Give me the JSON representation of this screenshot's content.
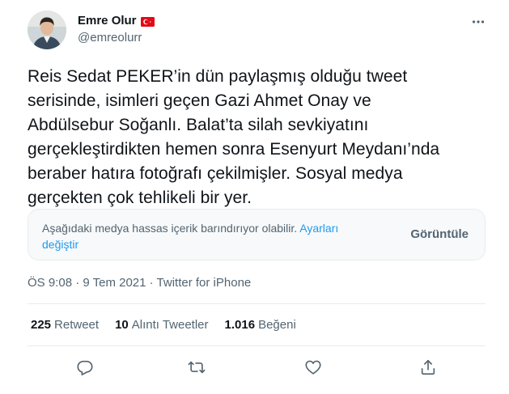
{
  "author": {
    "display_name": "Emre Olur",
    "handle": "@emreolurr",
    "flag_icon": "turkey-flag-icon"
  },
  "tweet": {
    "lines": [
      "Reis Sedat PEKER’in dün paylaşmış olduğu tweet",
      "serisinde, isimleri geçen Gazi Ahmet Onay ve",
      "Abdülsebur Soğanlı. Balat’ta silah sevkiyatını",
      "gerçekleştirdikten hemen sonra Esenyurt Meydanı’nda",
      "beraber hatıra fotoğrafı çekilmişler. Sosyal medya",
      "gerçekten çok tehlikeli bir yer."
    ]
  },
  "sensitive_media": {
    "warning": "Aşağıdaki medya hassas içerik barındırıyor olabilir. ",
    "settings_link": "Ayarları değiştir",
    "view_label": "Görüntüle"
  },
  "meta": {
    "timestamp": "ÖS 9:08 · 9 Tem 2021 · Twitter for iPhone"
  },
  "stats": {
    "retweets_count": "225",
    "retweets_label": "Retweet",
    "quotes_count": "10",
    "quotes_label": "Alıntı Tweetler",
    "likes_count": "1.016",
    "likes_label": "Beğeni"
  },
  "colors": {
    "accent": "#1d9bf0",
    "secondary_text": "#536471",
    "primary_text": "#0f1419",
    "flag_red": "#e30a17"
  },
  "icons": {
    "more": "more-dots-icon",
    "reply": "reply-icon",
    "retweet": "retweet-icon",
    "like": "heart-icon",
    "share": "share-icon"
  }
}
